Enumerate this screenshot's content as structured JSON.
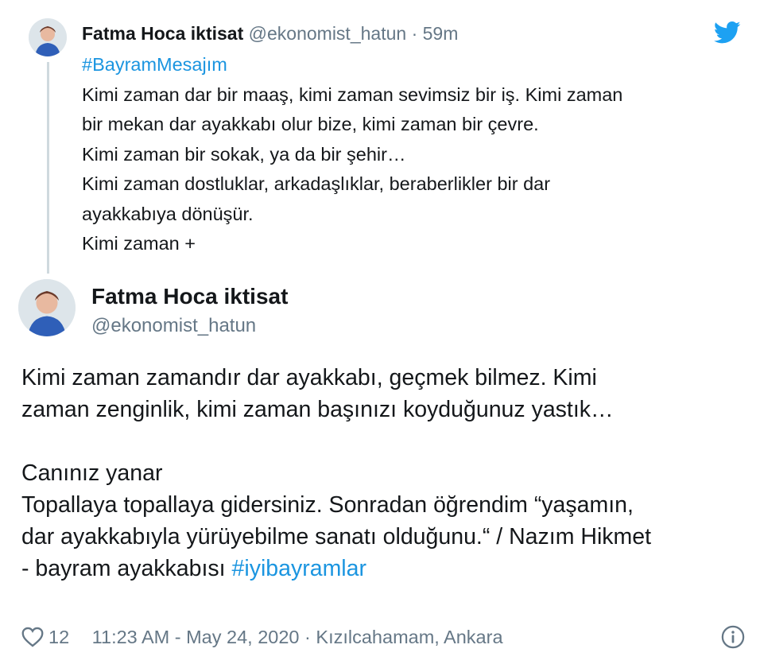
{
  "colors": {
    "link": "#1b95e0",
    "muted": "#657786",
    "text": "#14171a",
    "thread_line": "#cfd9de",
    "twitter_blue": "#1da1f2"
  },
  "reply_tweet": {
    "author_name": "Fatma Hoca iktisat",
    "author_handle": "@ekonomist_hatun",
    "separator": "·",
    "time": "59m",
    "hashtag": "#BayramMesajım",
    "lines": [
      "Kimi zaman dar bir maaş, kimi zaman sevimsiz bir iş. Kimi zaman",
      "bir mekan dar ayakkabı olur bize, kimi zaman bir çevre.",
      "Kimi zaman bir sokak, ya da bir şehir…",
      "Kimi zaman dostluklar, arkadaşlıklar, beraberlikler bir dar",
      "ayakkabıya dönüşür.",
      "Kimi zaman +"
    ],
    "brand_icon": "twitter-bird-icon"
  },
  "main_tweet": {
    "author_name": "Fatma Hoca iktisat",
    "author_handle": "@ekonomist_hatun",
    "lines": [
      "Kimi zaman zamandır dar ayakkabı, geçmek bilmez. Kimi",
      "zaman zenginlik, kimi zaman başınızı koyduğunuz yastık…",
      "",
      "Canınız yanar",
      "Topallaya topallaya gidersiniz. Sonradan öğrendim “yaşamın,",
      "dar ayakkabıyla yürüyebilme sanatı olduğunu.“ / Nazım Hikmet"
    ],
    "last_line_text": "- bayram ayakkabısı ",
    "last_line_hashtag": "#iyibayramlar",
    "like_count": "12",
    "timestamp": "11:23 AM - May 24, 2020",
    "dot": "·",
    "location": "Kızılcahamam, Ankara",
    "footer_icons": [
      "heart-icon",
      "info-icon"
    ]
  }
}
